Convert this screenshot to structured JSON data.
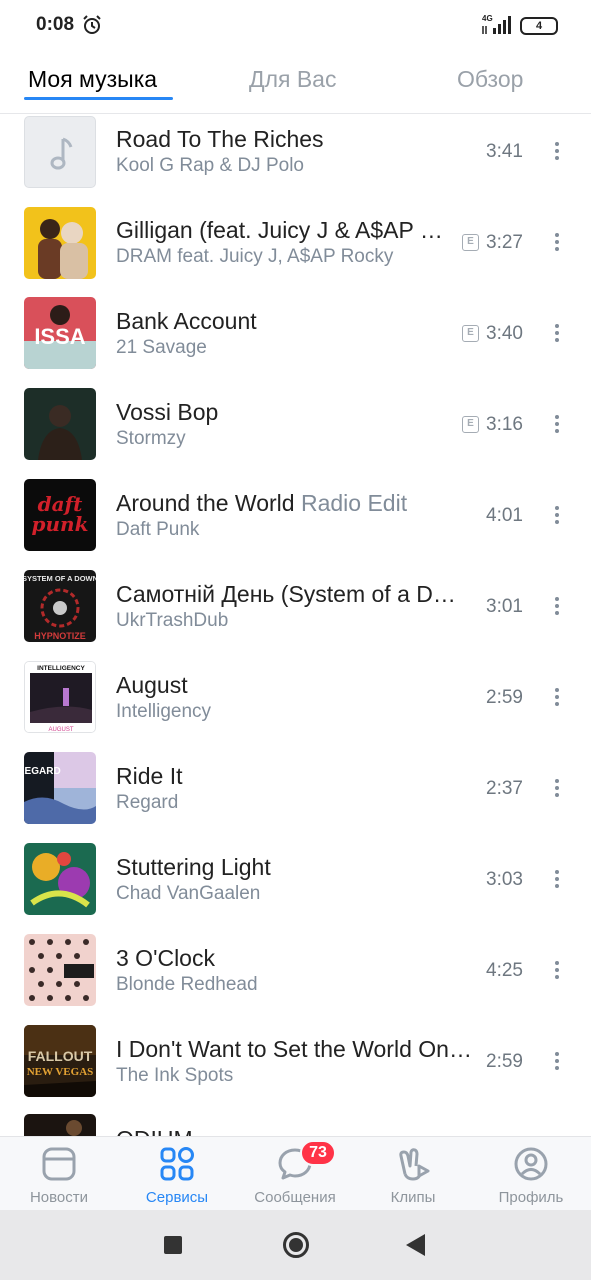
{
  "status_bar": {
    "time": "0:08",
    "network_label": "4G",
    "battery_level": "4",
    "alarm_icon": "alarm-clock-icon"
  },
  "tabs": [
    {
      "label": "Моя музыка",
      "active": true
    },
    {
      "label": "Для Вас",
      "active": false
    },
    {
      "label": "Обзор",
      "active": false
    }
  ],
  "tracks": [
    {
      "title": "Road To The Riches",
      "title_suffix": "",
      "artist": "Kool G Rap & DJ Polo",
      "duration": "3:41",
      "explicit": false,
      "cover": "music-note-placeholder"
    },
    {
      "title": "Gilligan (feat. Juicy J & A$AP Rocky)",
      "title_suffix": "",
      "artist": "DRAM feat. Juicy J, A$AP Rocky",
      "duration": "3:27",
      "explicit": true,
      "cover": "yellow-two-people"
    },
    {
      "title": "Bank Account",
      "title_suffix": "",
      "artist": "21 Savage",
      "duration": "3:40",
      "explicit": true,
      "cover": "issa-red"
    },
    {
      "title": "Vossi Bop",
      "title_suffix": "",
      "artist": "Stormzy",
      "duration": "3:16",
      "explicit": true,
      "cover": "dark-green-portrait"
    },
    {
      "title": "Around the World",
      "title_suffix": "Radio Edit",
      "artist": "Daft Punk",
      "duration": "4:01",
      "explicit": false,
      "cover": "daft-punk-black-red"
    },
    {
      "title": "Самотній День (System of a Down cover)",
      "title_suffix": "",
      "artist": "UkrTrashDub",
      "duration": "3:01",
      "explicit": false,
      "cover": "hypnotize-soad"
    },
    {
      "title": "August",
      "title_suffix": "",
      "artist": "Intelligency",
      "duration": "2:59",
      "explicit": false,
      "cover": "intelligency-dark"
    },
    {
      "title": "Ride It",
      "title_suffix": "",
      "artist": "Regard",
      "duration": "2:37",
      "explicit": false,
      "cover": "regard-pastel"
    },
    {
      "title": "Stuttering Light",
      "title_suffix": "",
      "artist": "Chad VanGaalen",
      "duration": "3:03",
      "explicit": false,
      "cover": "colorful-cartoon"
    },
    {
      "title": "3 O'Clock",
      "title_suffix": "",
      "artist": "Blonde Redhead",
      "duration": "4:25",
      "explicit": false,
      "cover": "pink-pattern"
    },
    {
      "title": "I Don't Want to Set the World On Fire",
      "title_suffix": "",
      "artist": "The Ink Spots",
      "duration": "2:59",
      "explicit": false,
      "cover": "fallout-new-vegas"
    },
    {
      "title": "ODIUM",
      "title_suffix": "",
      "artist": "",
      "duration": "",
      "explicit": false,
      "cover": "dark-partial"
    }
  ],
  "explicit_badge": "E",
  "cover_text": {
    "issa": "ISSA",
    "daft": "daft",
    "punk": "punk",
    "soad": "SYSTEM OF A DOWN",
    "hypnotize": "HYPNOTIZE",
    "intelligency": "INTELLIGENCY",
    "august": "AUGUST",
    "regard": "REGARD",
    "fallout": "FALLOUT",
    "new_vegas": "NEW VEGAS"
  },
  "bottom_nav": [
    {
      "label": "Новости",
      "icon": "news-icon",
      "active": false
    },
    {
      "label": "Сервисы",
      "icon": "services-grid-icon",
      "active": true
    },
    {
      "label": "Сообщения",
      "icon": "messages-bubble-icon",
      "active": false,
      "badge": "73"
    },
    {
      "label": "Клипы",
      "icon": "clips-icon",
      "active": false
    },
    {
      "label": "Профиль",
      "icon": "profile-icon",
      "active": false
    }
  ],
  "colors": {
    "accent": "#2787f5",
    "secondary_text": "#818c99",
    "badge": "#ff3347"
  }
}
